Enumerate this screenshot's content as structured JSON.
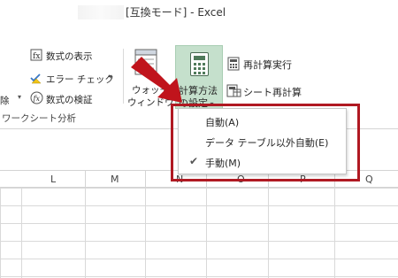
{
  "window": {
    "title": "[互換モード] - Excel"
  },
  "ribbon": {
    "show_formulas": "数式の表示",
    "error_check": "エラー チェック",
    "evaluate_formula": "数式の検証",
    "remove_partial": "除",
    "watch_window_line1": "ウォッチ",
    "watch_window_line2": "ウィンドウ",
    "calc_options_line1": "計算方法",
    "calc_options_line2": "の設定",
    "calc_now": "再計算実行",
    "calc_sheet": "シート再計算",
    "group_label": "ワークシート分析"
  },
  "menu": {
    "items": [
      {
        "label": "自動(A)",
        "checked": false
      },
      {
        "label": "データ テーブル以外自動(E)",
        "checked": false
      },
      {
        "label": "手動(M)",
        "checked": true
      }
    ],
    "check_glyph": "✔"
  },
  "columns": [
    "L",
    "M",
    "N",
    "O",
    "P",
    "Q"
  ],
  "colors": {
    "accent_green": "#c5e0cc",
    "highlight_red": "#b01922",
    "arrow_red": "#c0141c"
  }
}
